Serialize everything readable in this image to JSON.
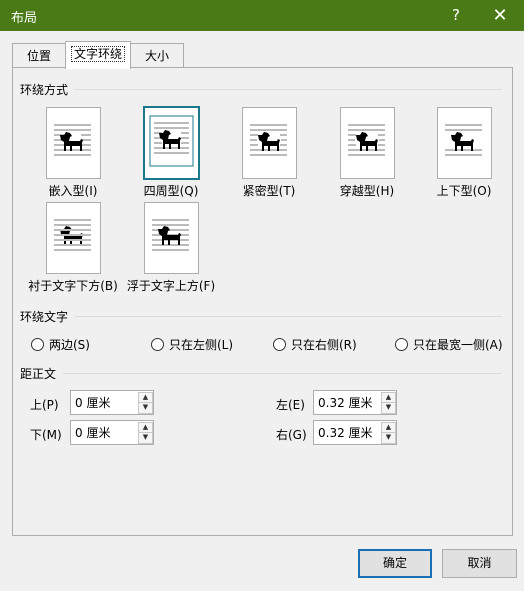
{
  "window": {
    "title": "布局",
    "help_label": "?",
    "close_label": "✕"
  },
  "tabs": [
    {
      "label": "位置"
    },
    {
      "label": "文字环绕"
    },
    {
      "label": "大小"
    }
  ],
  "wrap_style": {
    "heading": "环绕方式",
    "options": [
      {
        "label": "嵌入型(I)",
        "icon": "inline-dog-icon"
      },
      {
        "label": "四周型(Q)",
        "icon": "square-dog-icon"
      },
      {
        "label": "紧密型(T)",
        "icon": "tight-dog-icon"
      },
      {
        "label": "穿越型(H)",
        "icon": "through-dog-icon"
      },
      {
        "label": "上下型(O)",
        "icon": "top-bottom-dog-icon"
      },
      {
        "label": "衬于文字下方(B)",
        "icon": "behind-text-dog-icon"
      },
      {
        "label": "浮于文字上方(F)",
        "icon": "in-front-text-dog-icon"
      }
    ],
    "selected": "四周型(Q)"
  },
  "wrap_text": {
    "heading": "环绕文字",
    "options": [
      "两边(S)",
      "只在左侧(L)",
      "只在右侧(R)",
      "只在最宽一侧(A)"
    ]
  },
  "distance": {
    "heading": "距正文",
    "top_label": "上(P)",
    "top_value": "0 厘米",
    "bottom_label": "下(M)",
    "bottom_value": "0 厘米",
    "left_label": "左(E)",
    "left_value": "0.32 厘米",
    "right_label": "右(G)",
    "right_value": "0.32 厘米"
  },
  "footer": {
    "ok_label": "确定",
    "cancel_label": "取消"
  },
  "colors": {
    "titlebar": "#4a7a16",
    "selection": "#1a7a8c",
    "primary_border": "#1b6fb5"
  }
}
